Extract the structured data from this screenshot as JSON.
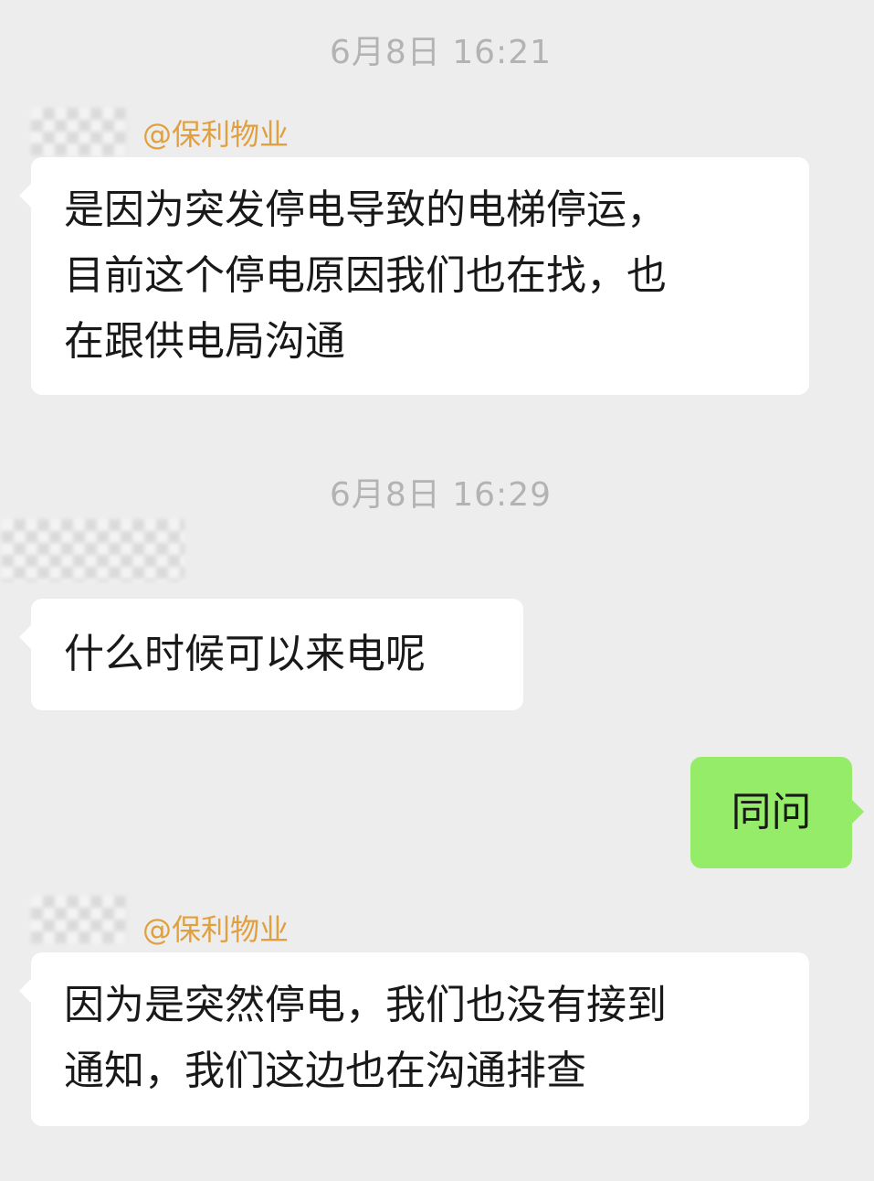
{
  "chat": {
    "timestamps": [
      "6月8日 16:21",
      "6月8日 16:29"
    ],
    "messages": [
      {
        "side": "incoming",
        "mention": "@保利物业",
        "lines": [
          "是因为突发停电导致的电梯停运，",
          "目前这个停电原因我们也在找，也",
          "在跟供电局沟通"
        ]
      },
      {
        "side": "incoming",
        "lines": [
          "什么时候可以来电呢"
        ]
      },
      {
        "side": "outgoing",
        "lines": [
          "同问"
        ]
      },
      {
        "side": "incoming",
        "mention": "@保利物业",
        "lines": [
          "因为是突然停电，我们也没有接到",
          "通知，我们这边也在沟通排查"
        ]
      }
    ]
  },
  "colors": {
    "background": "#ededed",
    "incoming_bubble": "#ffffff",
    "outgoing_bubble": "#95ec69",
    "mention": "#e0a040",
    "timestamp": "#b3b3b3"
  },
  "icons": {
    "avatar": "blurred-avatar-icon"
  }
}
